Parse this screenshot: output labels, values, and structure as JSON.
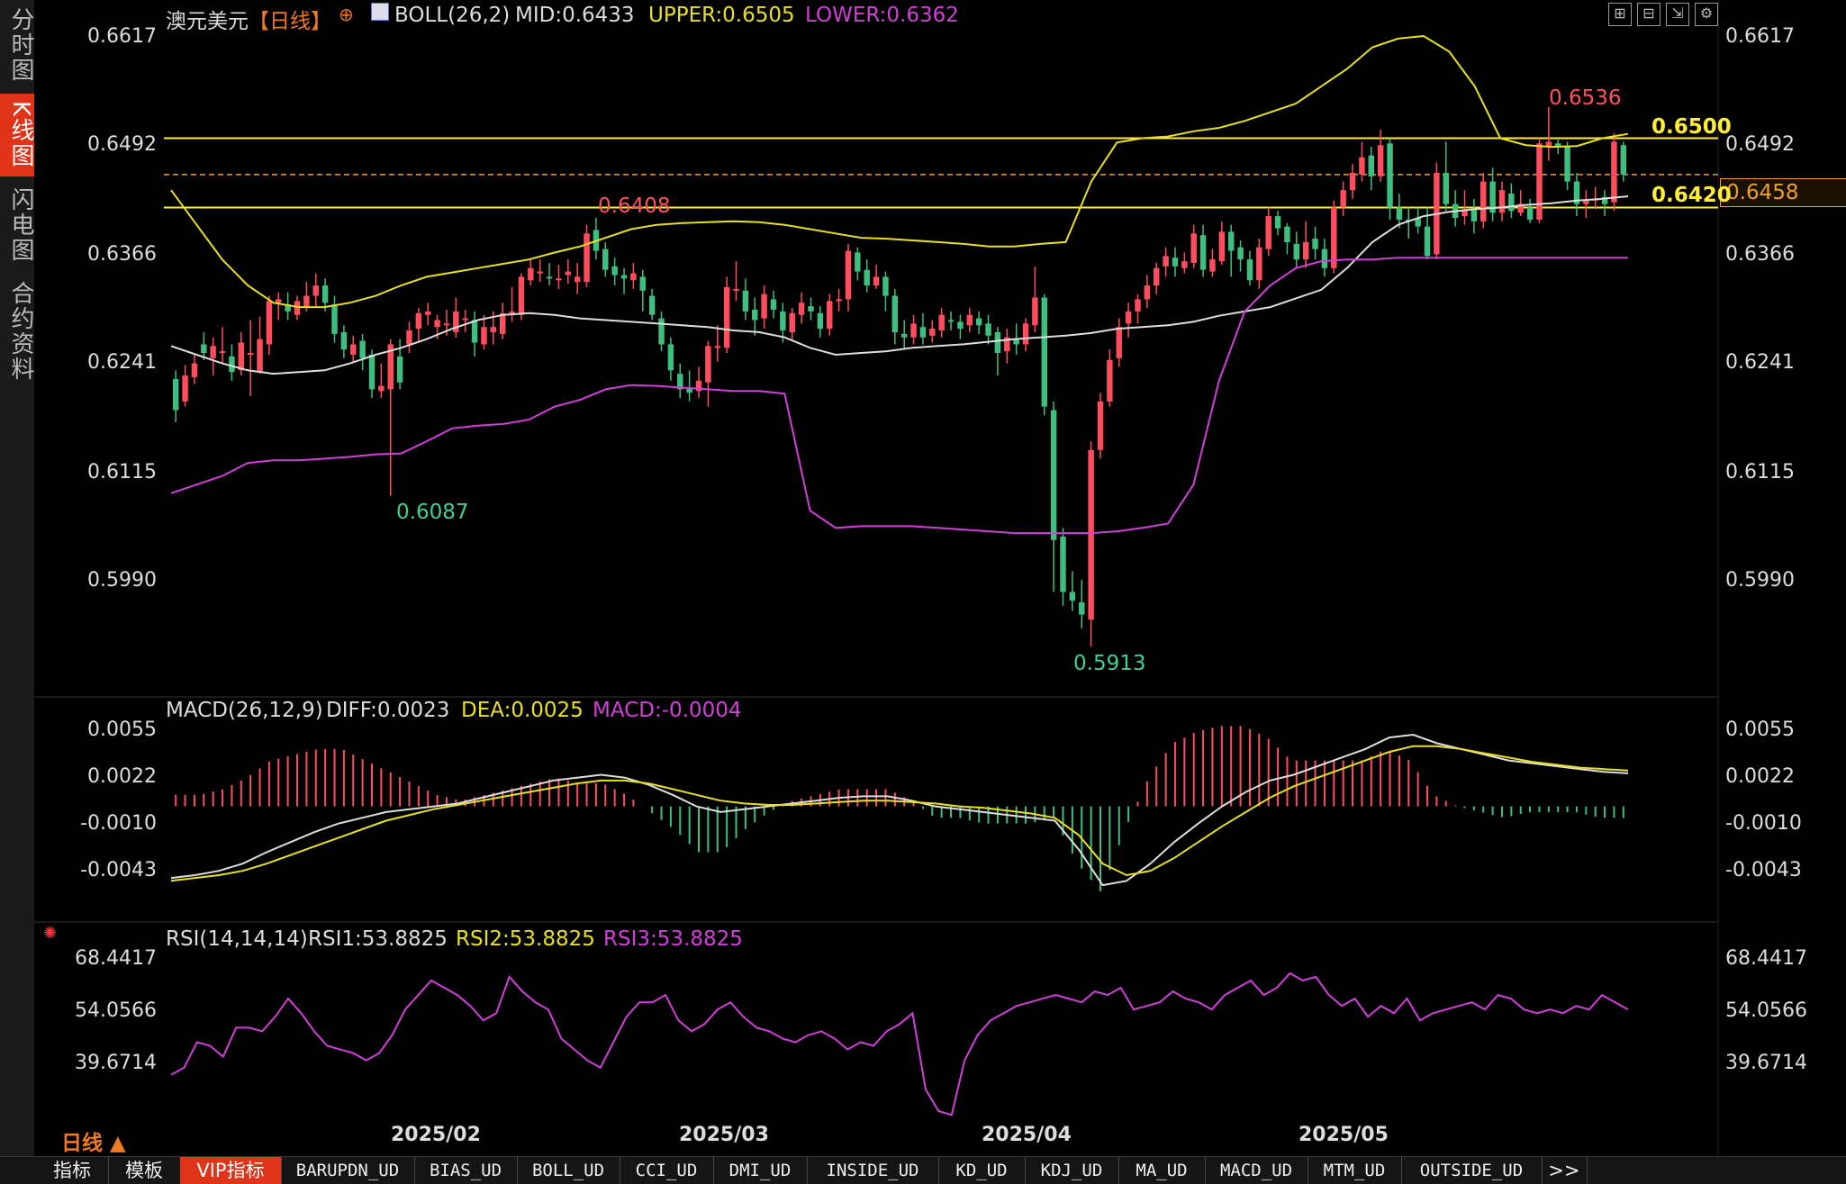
{
  "side_tabs": [
    {
      "label": "分时图",
      "active": false
    },
    {
      "label": "K线图",
      "active": true
    },
    {
      "label": "闪电图",
      "active": false
    },
    {
      "label": "合约资料",
      "active": false
    }
  ],
  "header": {
    "symbol": "澳元美元",
    "period_tag": "【日线】",
    "indicator_name": "BOLL(26,2)",
    "mid": "MID:0.6433",
    "upper": "UPPER:0.6505",
    "lower": "LOWER:0.6362"
  },
  "toolbar_icons": [
    "grid-icon",
    "split-icon",
    "export-icon",
    "settings-icon"
  ],
  "price_axis": [
    "0.6617",
    "0.6492",
    "0.6366",
    "0.6241",
    "0.6115",
    "0.5990"
  ],
  "current_price_tag": "0.6458",
  "horizontal_lines": [
    {
      "label": "0.6500",
      "color": "#ffee33"
    },
    {
      "label": "0.6420",
      "color": "#ffee33"
    }
  ],
  "annotations": {
    "high_1": "0.6408",
    "low_1": "0.6087",
    "low_2": "0.5913",
    "high_2": "0.6536"
  },
  "macd": {
    "title": "MACD(26,12,9)",
    "diff": "DIFF:0.0023",
    "dea": "DEA:0.0025",
    "macd": "MACD:-0.0004",
    "axis": [
      "0.0055",
      "0.0022",
      "-0.0010",
      "-0.0043"
    ]
  },
  "rsi": {
    "title": "RSI(14,14,14)",
    "rsi1": "RSI1:53.8825",
    "rsi2": "RSI2:53.8825",
    "rsi3": "RSI3:53.8825",
    "axis": [
      "68.4417",
      "54.0566",
      "39.6714"
    ]
  },
  "dates": [
    "2025/02",
    "2025/03",
    "2025/04",
    "2025/05"
  ],
  "period_switch": "日线 ▲",
  "bottom_tabs": [
    "指标",
    "模板",
    "VIP指标",
    "BARUPDN_UD",
    "BIAS_UD",
    "BOLL_UD",
    "CCI_UD",
    "DMI_UD",
    "INSIDE_UD",
    "KD_UD",
    "KDJ_UD",
    "MA_UD",
    "MACD_UD",
    "MTM_UD",
    "OUTSIDE_UD",
    ">>"
  ],
  "colors": {
    "up": "#ff4d5e",
    "down": "#3fbf7f",
    "upper_band": "#e8e020",
    "mid_band": "#dddddd",
    "lower_band": "#d040d8",
    "accent": "#e0341a"
  },
  "chart_data": {
    "type": "candlestick",
    "candles": [
      [
        0.6222,
        0.6186,
        0.6232,
        0.6172
      ],
      [
        0.6196,
        0.6226,
        0.6238,
        0.619
      ],
      [
        0.6224,
        0.624,
        0.625,
        0.6216
      ],
      [
        0.6262,
        0.6252,
        0.6276,
        0.6244
      ],
      [
        0.6246,
        0.626,
        0.627,
        0.6226
      ],
      [
        0.6254,
        0.6254,
        0.6282,
        0.624
      ],
      [
        0.6248,
        0.623,
        0.6262,
        0.622
      ],
      [
        0.6232,
        0.6264,
        0.6276,
        0.6226
      ],
      [
        0.6252,
        0.6252,
        0.629,
        0.6202
      ],
      [
        0.623,
        0.6268,
        0.6294,
        0.6228
      ],
      [
        0.6262,
        0.6312,
        0.6318,
        0.625
      ],
      [
        0.631,
        0.6314,
        0.6322,
        0.629
      ],
      [
        0.6308,
        0.63,
        0.6322,
        0.629
      ],
      [
        0.6296,
        0.6312,
        0.6318,
        0.629
      ],
      [
        0.6306,
        0.6318,
        0.6334,
        0.63
      ],
      [
        0.6318,
        0.633,
        0.6344,
        0.6304
      ],
      [
        0.633,
        0.631,
        0.6338,
        0.63
      ],
      [
        0.6308,
        0.6274,
        0.6318,
        0.6264
      ],
      [
        0.6276,
        0.6256,
        0.6284,
        0.6246
      ],
      [
        0.625,
        0.6262,
        0.6272,
        0.6242
      ],
      [
        0.6266,
        0.6246,
        0.6274,
        0.6232
      ],
      [
        0.625,
        0.621,
        0.6256,
        0.62
      ],
      [
        0.6208,
        0.6214,
        0.624,
        0.62
      ],
      [
        0.621,
        0.6262,
        0.6268,
        0.6087
      ],
      [
        0.6248,
        0.6218,
        0.6268,
        0.621
      ],
      [
        0.6262,
        0.6278,
        0.6288,
        0.6252
      ],
      [
        0.628,
        0.6298,
        0.6304,
        0.6264
      ],
      [
        0.6296,
        0.63,
        0.631,
        0.6284
      ],
      [
        0.6282,
        0.629,
        0.6296,
        0.6268
      ],
      [
        0.6284,
        0.6286,
        0.6302,
        0.6272
      ],
      [
        0.6276,
        0.63,
        0.6316,
        0.627
      ],
      [
        0.629,
        0.6292,
        0.6302,
        0.6276
      ],
      [
        0.629,
        0.6264,
        0.63,
        0.6248
      ],
      [
        0.6262,
        0.6282,
        0.6296,
        0.6256
      ],
      [
        0.6276,
        0.6282,
        0.63,
        0.6262
      ],
      [
        0.6274,
        0.6298,
        0.631,
        0.6268
      ],
      [
        0.63,
        0.63,
        0.6328,
        0.6288
      ],
      [
        0.6296,
        0.634,
        0.6344,
        0.629
      ],
      [
        0.6336,
        0.635,
        0.636,
        0.633
      ],
      [
        0.6346,
        0.6346,
        0.636,
        0.6334
      ],
      [
        0.634,
        0.6338,
        0.6356,
        0.633
      ],
      [
        0.6338,
        0.6338,
        0.6354,
        0.6326
      ],
      [
        0.6342,
        0.6346,
        0.636,
        0.6332
      ],
      [
        0.6334,
        0.634,
        0.6356,
        0.632
      ],
      [
        0.6334,
        0.639,
        0.64,
        0.6328
      ],
      [
        0.6394,
        0.637,
        0.6408,
        0.636
      ],
      [
        0.6372,
        0.6348,
        0.638,
        0.634
      ],
      [
        0.6352,
        0.6342,
        0.6362,
        0.633
      ],
      [
        0.6342,
        0.6338,
        0.635,
        0.632
      ],
      [
        0.6336,
        0.6344,
        0.6356,
        0.6326
      ],
      [
        0.634,
        0.6324,
        0.6348,
        0.63
      ],
      [
        0.6318,
        0.6296,
        0.6326,
        0.629
      ],
      [
        0.6292,
        0.6262,
        0.63,
        0.6254
      ],
      [
        0.6262,
        0.6232,
        0.627,
        0.622
      ],
      [
        0.6228,
        0.621,
        0.624,
        0.62
      ],
      [
        0.6212,
        0.6206,
        0.6232,
        0.6196
      ],
      [
        0.6208,
        0.622,
        0.6236,
        0.62
      ],
      [
        0.6218,
        0.626,
        0.6266,
        0.619
      ],
      [
        0.6258,
        0.626,
        0.6284,
        0.6242
      ],
      [
        0.6258,
        0.6328,
        0.634,
        0.6252
      ],
      [
        0.6324,
        0.6326,
        0.6358,
        0.6312
      ],
      [
        0.6324,
        0.63,
        0.6338,
        0.629
      ],
      [
        0.6302,
        0.629,
        0.6316,
        0.6272
      ],
      [
        0.6292,
        0.632,
        0.633,
        0.628
      ],
      [
        0.6314,
        0.6302,
        0.6324,
        0.6292
      ],
      [
        0.63,
        0.6278,
        0.631,
        0.6264
      ],
      [
        0.6276,
        0.6298,
        0.6304,
        0.6266
      ],
      [
        0.6296,
        0.631,
        0.6322,
        0.6286
      ],
      [
        0.6306,
        0.63,
        0.6316,
        0.629
      ],
      [
        0.6298,
        0.628,
        0.6306,
        0.627
      ],
      [
        0.628,
        0.6312,
        0.632,
        0.6272
      ],
      [
        0.6312,
        0.6314,
        0.6326,
        0.63
      ],
      [
        0.6314,
        0.637,
        0.6378,
        0.63
      ],
      [
        0.6368,
        0.6346,
        0.6374,
        0.6336
      ],
      [
        0.6348,
        0.633,
        0.636,
        0.6322
      ],
      [
        0.633,
        0.634,
        0.6354,
        0.6326
      ],
      [
        0.634,
        0.6318,
        0.6346,
        0.63
      ],
      [
        0.6318,
        0.6276,
        0.6326,
        0.6262
      ],
      [
        0.6274,
        0.627,
        0.629,
        0.6256
      ],
      [
        0.627,
        0.6286,
        0.6296,
        0.6262
      ],
      [
        0.6282,
        0.627,
        0.6298,
        0.6262
      ],
      [
        0.6272,
        0.628,
        0.629,
        0.6264
      ],
      [
        0.6278,
        0.6296,
        0.6304,
        0.627
      ],
      [
        0.629,
        0.6288,
        0.63,
        0.6278
      ],
      [
        0.6288,
        0.628,
        0.6296,
        0.6268
      ],
      [
        0.6284,
        0.6296,
        0.6304,
        0.6276
      ],
      [
        0.6292,
        0.6284,
        0.63,
        0.6274
      ],
      [
        0.6286,
        0.6272,
        0.6296,
        0.6262
      ],
      [
        0.6276,
        0.6252,
        0.6282,
        0.6226
      ],
      [
        0.6254,
        0.627,
        0.628,
        0.624
      ],
      [
        0.6268,
        0.6262,
        0.6286,
        0.625
      ],
      [
        0.6262,
        0.6286,
        0.6292,
        0.6254
      ],
      [
        0.6284,
        0.6316,
        0.6352,
        0.6276
      ],
      [
        0.6316,
        0.619,
        0.632,
        0.618
      ],
      [
        0.6186,
        0.6036,
        0.6196,
        0.5976
      ],
      [
        0.604,
        0.5976,
        0.605,
        0.596
      ],
      [
        0.5976,
        0.5966,
        0.6,
        0.5954
      ],
      [
        0.5964,
        0.595,
        0.599,
        0.5934
      ],
      [
        0.5944,
        0.614,
        0.615,
        0.5913
      ],
      [
        0.614,
        0.6196,
        0.6206,
        0.613
      ],
      [
        0.6196,
        0.6244,
        0.6256,
        0.619
      ],
      [
        0.6246,
        0.6282,
        0.6292,
        0.6236
      ],
      [
        0.6286,
        0.63,
        0.631,
        0.627
      ],
      [
        0.63,
        0.6314,
        0.632,
        0.6286
      ],
      [
        0.6314,
        0.633,
        0.6342,
        0.6304
      ],
      [
        0.633,
        0.635,
        0.6356,
        0.632
      ],
      [
        0.6352,
        0.6364,
        0.6374,
        0.634
      ],
      [
        0.6362,
        0.6352,
        0.6374,
        0.634
      ],
      [
        0.635,
        0.6358,
        0.6368,
        0.6344
      ],
      [
        0.6356,
        0.639,
        0.64,
        0.635
      ],
      [
        0.6388,
        0.6348,
        0.64,
        0.634
      ],
      [
        0.6346,
        0.636,
        0.6372,
        0.634
      ],
      [
        0.6358,
        0.6392,
        0.6404,
        0.6354
      ],
      [
        0.6392,
        0.637,
        0.64,
        0.634
      ],
      [
        0.6374,
        0.636,
        0.6382,
        0.6346
      ],
      [
        0.636,
        0.6336,
        0.637,
        0.633
      ],
      [
        0.6336,
        0.6374,
        0.6384,
        0.6326
      ],
      [
        0.6372,
        0.641,
        0.642,
        0.6364
      ],
      [
        0.641,
        0.6396,
        0.6416,
        0.6388
      ],
      [
        0.6398,
        0.638,
        0.6402,
        0.6366
      ],
      [
        0.6378,
        0.636,
        0.6392,
        0.635
      ],
      [
        0.636,
        0.638,
        0.6404,
        0.635
      ],
      [
        0.6384,
        0.6372,
        0.6398,
        0.636
      ],
      [
        0.6372,
        0.635,
        0.6384,
        0.634
      ],
      [
        0.635,
        0.642,
        0.6428,
        0.6344
      ],
      [
        0.642,
        0.644,
        0.645,
        0.641
      ],
      [
        0.644,
        0.646,
        0.647,
        0.643
      ],
      [
        0.6458,
        0.6478,
        0.6496,
        0.645
      ],
      [
        0.648,
        0.6456,
        0.649,
        0.644
      ],
      [
        0.6456,
        0.6492,
        0.651,
        0.645
      ],
      [
        0.6494,
        0.642,
        0.65,
        0.6406
      ],
      [
        0.642,
        0.6406,
        0.6436,
        0.6396
      ],
      [
        0.6406,
        0.6404,
        0.642,
        0.6384
      ],
      [
        0.6408,
        0.6398,
        0.642,
        0.639
      ],
      [
        0.6398,
        0.6364,
        0.642,
        0.636
      ],
      [
        0.6366,
        0.646,
        0.6472,
        0.636
      ],
      [
        0.646,
        0.6424,
        0.6496,
        0.6416
      ],
      [
        0.6424,
        0.6408,
        0.644,
        0.6398
      ],
      [
        0.641,
        0.6418,
        0.644,
        0.64
      ],
      [
        0.6418,
        0.6404,
        0.643,
        0.639
      ],
      [
        0.6404,
        0.645,
        0.646,
        0.6396
      ],
      [
        0.645,
        0.6414,
        0.6466,
        0.6404
      ],
      [
        0.6414,
        0.644,
        0.645,
        0.6404
      ],
      [
        0.6436,
        0.6416,
        0.6448,
        0.6408
      ],
      [
        0.6414,
        0.6424,
        0.644,
        0.641
      ],
      [
        0.642,
        0.6406,
        0.643,
        0.6402
      ],
      [
        0.6406,
        0.6494,
        0.65,
        0.6402
      ],
      [
        0.649,
        0.6496,
        0.6536,
        0.6474
      ],
      [
        0.6494,
        0.649,
        0.65,
        0.6482
      ],
      [
        0.649,
        0.645,
        0.6496,
        0.644
      ],
      [
        0.645,
        0.6424,
        0.646,
        0.641
      ],
      [
        0.6424,
        0.6428,
        0.644,
        0.6408
      ],
      [
        0.643,
        0.643,
        0.6444,
        0.6418
      ],
      [
        0.6432,
        0.6424,
        0.644,
        0.641
      ],
      [
        0.6426,
        0.6496,
        0.6506,
        0.6416
      ],
      [
        0.6492,
        0.6458,
        0.6496,
        0.645
      ]
    ],
    "boll_upper": [
      0.644,
      0.64,
      0.636,
      0.633,
      0.631,
      0.6305,
      0.6305,
      0.631,
      0.6318,
      0.633,
      0.634,
      0.6345,
      0.635,
      0.6355,
      0.636,
      0.6368,
      0.6375,
      0.6385,
      0.6395,
      0.64,
      0.6402,
      0.6403,
      0.6404,
      0.6403,
      0.64,
      0.6395,
      0.639,
      0.6385,
      0.6384,
      0.6382,
      0.638,
      0.6378,
      0.6375,
      0.6375,
      0.6378,
      0.638,
      0.645,
      0.6495,
      0.65,
      0.6502,
      0.6508,
      0.6512,
      0.652,
      0.653,
      0.654,
      0.656,
      0.658,
      0.6605,
      0.6615,
      0.6618,
      0.66,
      0.656,
      0.65,
      0.6492,
      0.649,
      0.6491,
      0.65,
      0.6505
    ],
    "boll_mid": [
      0.626,
      0.625,
      0.624,
      0.6232,
      0.6228,
      0.623,
      0.6232,
      0.624,
      0.625,
      0.6258,
      0.6268,
      0.628,
      0.629,
      0.6296,
      0.6298,
      0.6296,
      0.6292,
      0.629,
      0.6288,
      0.6286,
      0.6284,
      0.6282,
      0.6278,
      0.6276,
      0.627,
      0.6258,
      0.625,
      0.6252,
      0.6254,
      0.6258,
      0.626,
      0.6262,
      0.6265,
      0.6268,
      0.627,
      0.6272,
      0.6275,
      0.628,
      0.6282,
      0.6284,
      0.6288,
      0.6295,
      0.63,
      0.6305,
      0.6315,
      0.6325,
      0.635,
      0.638,
      0.64,
      0.641,
      0.6415,
      0.6418,
      0.642,
      0.6423,
      0.6425,
      0.6428,
      0.643,
      0.6433
    ],
    "boll_lower": [
      0.609,
      0.61,
      0.611,
      0.6125,
      0.6128,
      0.6128,
      0.613,
      0.6132,
      0.6135,
      0.6136,
      0.615,
      0.6165,
      0.6168,
      0.617,
      0.6175,
      0.619,
      0.6198,
      0.621,
      0.6215,
      0.6214,
      0.6212,
      0.621,
      0.6208,
      0.6208,
      0.6205,
      0.607,
      0.605,
      0.6052,
      0.6052,
      0.6052,
      0.605,
      0.6048,
      0.6046,
      0.6044,
      0.6044,
      0.6044,
      0.6044,
      0.6046,
      0.605,
      0.6055,
      0.61,
      0.622,
      0.63,
      0.633,
      0.635,
      0.6358,
      0.636,
      0.636,
      0.6362,
      0.6362,
      0.6362,
      0.6362,
      0.6362,
      0.6362,
      0.6362,
      0.6362,
      0.6362,
      0.6362
    ],
    "macd_diff": [
      -0.005,
      -0.0048,
      -0.0045,
      -0.004,
      -0.0032,
      -0.0025,
      -0.0018,
      -0.0012,
      -0.0008,
      -0.0004,
      -0.0002,
      0.0,
      0.0002,
      0.0006,
      0.001,
      0.0014,
      0.0018,
      0.002,
      0.0022,
      0.002,
      0.0015,
      0.0008,
      0.0,
      -0.0004,
      -0.0002,
      0.0,
      0.0002,
      0.0004,
      0.0006,
      0.0007,
      0.0007,
      0.0004,
      0.0,
      -0.0002,
      -0.0004,
      -0.0006,
      -0.0008,
      -0.001,
      -0.003,
      -0.0055,
      -0.0052,
      -0.004,
      -0.0025,
      -0.0012,
      0.0,
      0.001,
      0.0018,
      0.0022,
      0.0028,
      0.0034,
      0.004,
      0.0048,
      0.005,
      0.0044,
      0.004,
      0.0036,
      0.0032,
      0.003,
      0.0028,
      0.0026,
      0.0024,
      0.0023
    ],
    "macd_dea": [
      -0.0052,
      -0.005,
      -0.0048,
      -0.0045,
      -0.004,
      -0.0034,
      -0.0028,
      -0.0022,
      -0.0016,
      -0.001,
      -0.0006,
      -0.0002,
      0.0001,
      0.0004,
      0.0007,
      0.001,
      0.0013,
      0.0016,
      0.0018,
      0.0018,
      0.0016,
      0.0012,
      0.0008,
      0.0004,
      0.0002,
      0.0001,
      0.0001,
      0.0002,
      0.0003,
      0.0004,
      0.0004,
      0.0003,
      0.0002,
      0.0,
      -0.0001,
      -0.0003,
      -0.0005,
      -0.0008,
      -0.002,
      -0.004,
      -0.0048,
      -0.0045,
      -0.0036,
      -0.0025,
      -0.0014,
      -0.0004,
      0.0006,
      0.0014,
      0.002,
      0.0026,
      0.0032,
      0.0038,
      0.0042,
      0.0042,
      0.004,
      0.0037,
      0.0034,
      0.0031,
      0.0029,
      0.0027,
      0.0026,
      0.0025
    ],
    "rsi": [
      36,
      38,
      45,
      44,
      41,
      49,
      49,
      48,
      52,
      57,
      53,
      48,
      44,
      43,
      42,
      40,
      42,
      47,
      54,
      58,
      62,
      60,
      58,
      55,
      51,
      53,
      63,
      59,
      56,
      54,
      46,
      43,
      40,
      38,
      45,
      52,
      56,
      56,
      58,
      51,
      48,
      50,
      54,
      56,
      52,
      49,
      48,
      46,
      45,
      47,
      48,
      46,
      43,
      45,
      44,
      48,
      50,
      53,
      32,
      26,
      25,
      40,
      47,
      51,
      53,
      55,
      56,
      57,
      58,
      57,
      56,
      59,
      58,
      60,
      54,
      55,
      56,
      59,
      57,
      56,
      54,
      58,
      60,
      62,
      58,
      60,
      64,
      62,
      63,
      58,
      55,
      57,
      52,
      55,
      53,
      57,
      51,
      53,
      54,
      55,
      56,
      54,
      58,
      57,
      54,
      53,
      54,
      53,
      55,
      54,
      58,
      56,
      54
    ]
  }
}
